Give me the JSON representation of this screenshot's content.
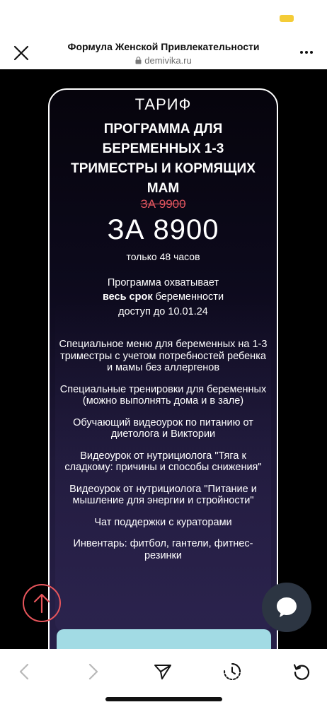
{
  "browser": {
    "page_title": "Формула Женской Привлекательности",
    "domain": "demivika.ru"
  },
  "tariff": {
    "label": "ТАРИФ",
    "program_name": "ПРОГРАММА ДЛЯ БЕРЕМЕННЫХ 1-3 ТРИМЕСТРЫ И КОРМЯЩИХ МАМ",
    "old_price": "ЗА 9900",
    "new_price": "ЗА 8900",
    "time_limit": "только 48 часов",
    "coverage_prefix": "Программа охватывает",
    "coverage_bold": "весь срок",
    "coverage_suffix": "беременности",
    "access": "доступ до 10.01.24"
  },
  "features": [
    "Специальное меню для беременных на 1-3 триместры с учетом потребностей ребенка и мамы без аллергенов",
    "Специальные тренировки для беременных (можно выполнять дома и в зале)",
    "Обучающий видеоурок по питанию от диетолога и Виктории",
    "Видеоурок от нутрициолога \"Тяга к сладкому: причины и способы снижения\"",
    "Видеоурок от нутрициолога \"Питание и мышление для энергии и стройности\"",
    "Чат поддержки с кураторами",
    "Инвентарь: фитбол, гантели, фитнес-резинки"
  ],
  "icons": {
    "close": "close-icon",
    "lock": "lock-icon",
    "more": "more-icon",
    "scroll_top": "arrow-up-icon",
    "chat": "chat-bubble-icon",
    "back": "chevron-left-icon",
    "forward": "chevron-right-icon",
    "share": "send-icon",
    "history": "history-icon",
    "reload": "reload-icon"
  },
  "colors": {
    "old_price": "#e0555e",
    "cta": "#a2dbe4",
    "scroll_top_ring": "#e7555b",
    "chat_button": "#2c3542",
    "battery": "#f4cc37"
  }
}
